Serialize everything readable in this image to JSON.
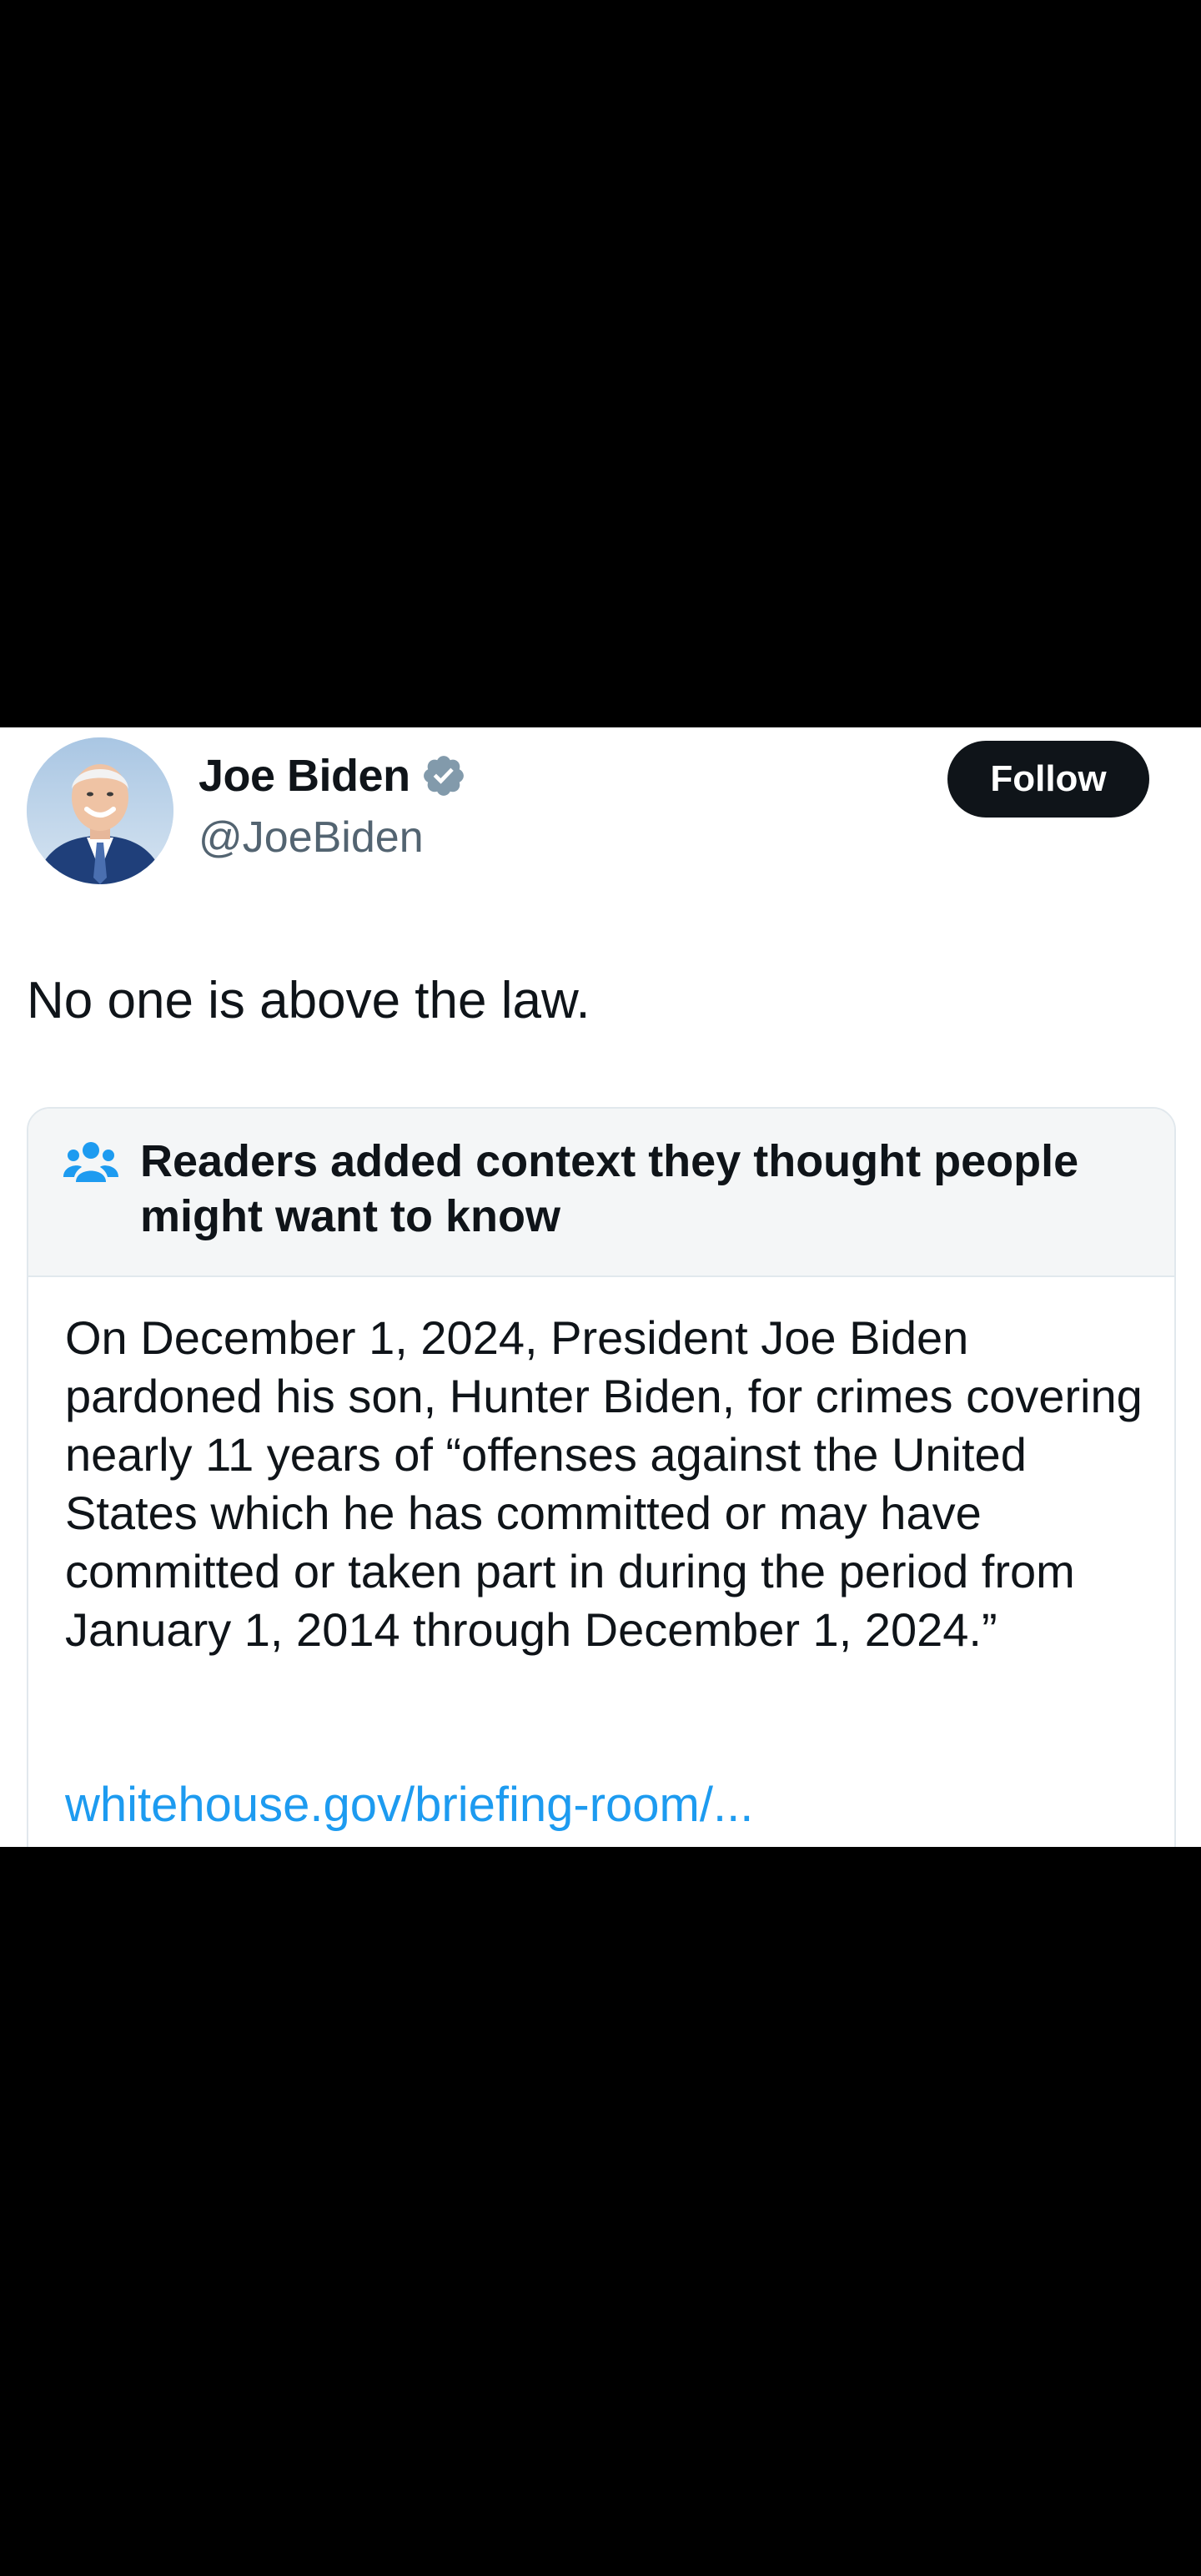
{
  "author": {
    "display_name": "Joe Biden",
    "handle": "@JoeBiden",
    "verified": true,
    "avatar_icon": "profile-photo"
  },
  "follow_button": {
    "label": "Follow"
  },
  "tweet": {
    "text": "No one is above the law."
  },
  "community_note": {
    "icon": "people-icon",
    "title": "Readers added context they thought people might want to know",
    "body": "On December 1, 2024, President Joe Biden pardoned his son, Hunter Biden, for crimes covering nearly 11 years of “offenses against the United States which he has committed or may have committed or taken part in during the period from January 1, 2014 through December 1, 2024.”",
    "link": "whitehouse.gov/briefing-room/..."
  },
  "colors": {
    "background_outer": "#000000",
    "card_background": "#ffffff",
    "text_primary": "#0f1419",
    "text_secondary": "#536471",
    "link_blue": "#1d9bf0",
    "verified_gray": "#829aab",
    "note_header_bg": "#f4f6f7"
  }
}
